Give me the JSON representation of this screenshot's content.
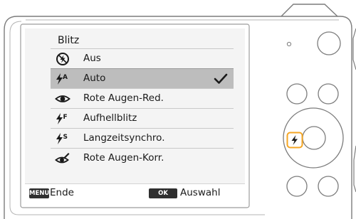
{
  "menu": {
    "title": "Blitz",
    "items": [
      {
        "label": "Aus",
        "icon": "flash-off-icon"
      },
      {
        "label": "Auto",
        "icon": "flash-auto-icon",
        "selected": true,
        "checked": true
      },
      {
        "label": "Rote Augen-Red.",
        "icon": "red-eye-icon"
      },
      {
        "label": "Aufhellblitz",
        "icon": "fill-flash-icon"
      },
      {
        "label": "Langzeitsynchro.",
        "icon": "slow-sync-icon"
      },
      {
        "label": "Rote Augen-Korr.",
        "icon": "red-eye-fix-icon"
      }
    ]
  },
  "bottom_bar": {
    "menu_key": "MENU",
    "menu_action": "Ende",
    "ok_key": "OK",
    "ok_action": "Auswahl"
  },
  "icon_glyphs": {
    "flash_auto_letter": "A",
    "fill_flash_letter": "F",
    "slow_sync_letter": "S"
  },
  "colors": {
    "highlight": "#f5a623",
    "selected_row": "#bdbdbd",
    "screen_bg": "#f4f4f4"
  }
}
